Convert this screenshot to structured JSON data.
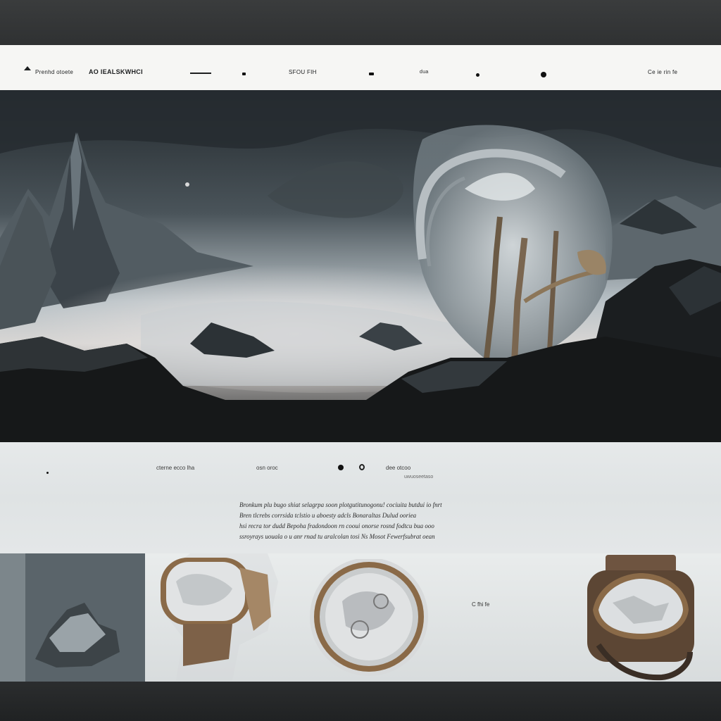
{
  "nav": {
    "brand": "Prenhd otoete",
    "brand_sub": "AO IEALSKWHCI",
    "center_label": "SFOU FIH",
    "right_small": "dua",
    "right_label": "Ce ie rin fe"
  },
  "info": {
    "label_left": "cterne ecco lha",
    "label_mid": "osn oroc",
    "label_right": "dee otcoo",
    "sub_right": "uwuoseetaso",
    "paragraph_lines": [
      "Bronkum plu bugo shiat  selagrpa soon plotgutitunogonu!  cociuita butdui io fnrt",
      "Bren tlcrebs  corrsida tclstio u  aboesty adcls  Bonaraltas Dulud  ooriea",
      "hsi  recra tor dudd  Bepoha  fradondoon rn  cooui onorse  rosnd fodtcu bua ooo",
      "ssroyrays uouala  o u anr  rnad tu aralcolan tosi  Ns  Mosot Fewerfsubrat oean"
    ]
  },
  "products": {
    "label": "C fhi fe"
  },
  "colors": {
    "nav_bg": "#f6f6f4",
    "info_bg": "#e3e6e7",
    "frame": "#2a2c2d",
    "bronze": "#8a6a48"
  }
}
